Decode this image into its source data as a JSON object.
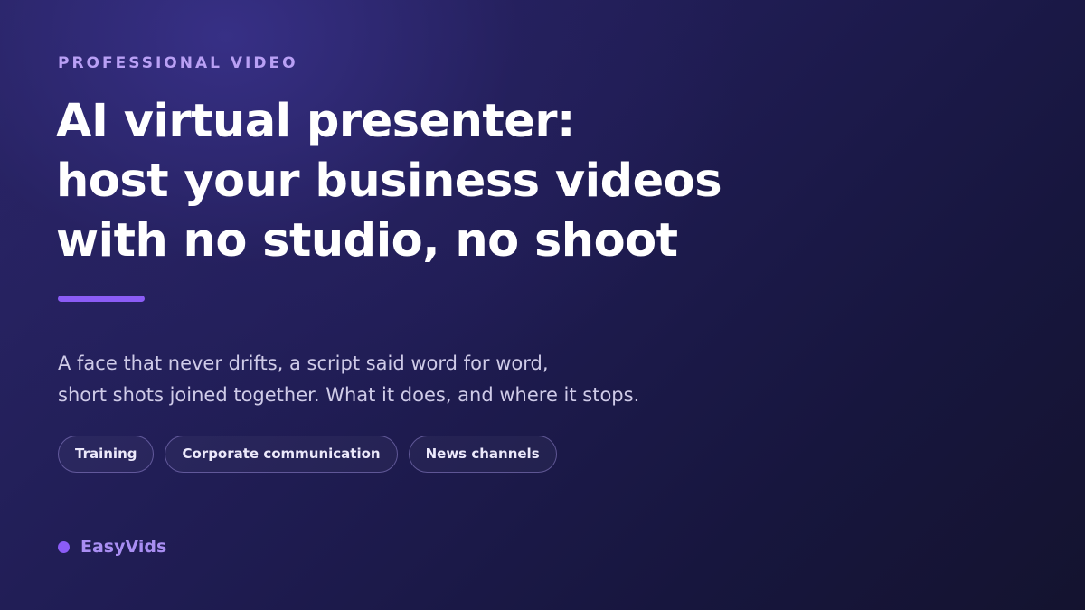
{
  "eyebrow": "PROFESSIONAL VIDEO",
  "headline": {
    "lines": [
      "AI virtual presenter:",
      "host your business videos",
      "with no studio, no shoot"
    ]
  },
  "subtitle": {
    "lines": [
      "A face that never drifts, a script said word for word,",
      "short shots joined together. What it does, and where it stops."
    ]
  },
  "tags": [
    {
      "label": "Training"
    },
    {
      "label": "Corporate communication"
    },
    {
      "label": "News channels"
    }
  ],
  "brand": {
    "name": "EasyVids"
  },
  "colors": {
    "background_dark": "#14132f",
    "background_glow": "#3a328c",
    "accent": "#8b5cf6",
    "eyebrow": "#b9a0f5",
    "brand_text": "#a98ef2",
    "headline": "#ffffff",
    "subtitle": "#cfcbe8"
  }
}
